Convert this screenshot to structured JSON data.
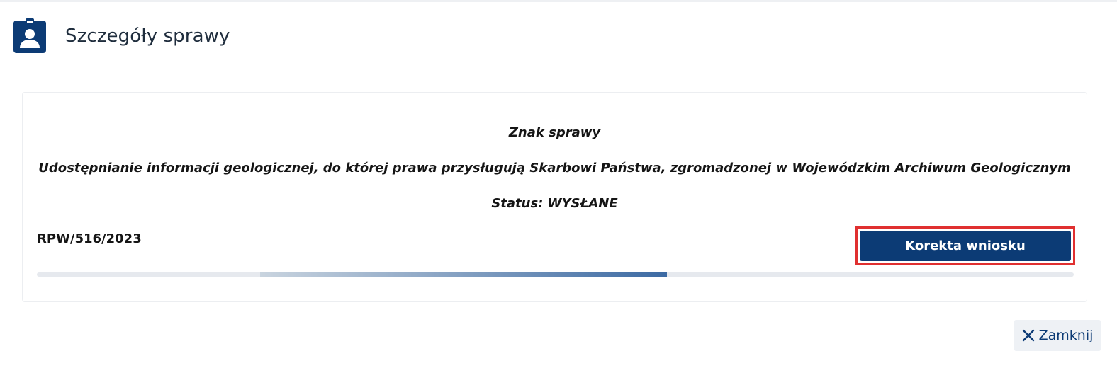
{
  "header": {
    "title": "Szczegóły sprawy",
    "icon": "id-badge-icon"
  },
  "case": {
    "label_title": "Znak sprawy",
    "description": "Udostępnianie informacji geologicznej, do której prawa przysługują Skarbowi Państwa, zgromadzonej w Wojewódzkim Archiwum Geologicznym",
    "status": "Status: WYSŁANE",
    "number": "RPW/516/2023",
    "progress": {
      "start_fraction": 0.215,
      "end_fraction": 0.608
    }
  },
  "actions": {
    "correction_label": "Korekta wniosku",
    "close_label": "Zamknij"
  },
  "colors": {
    "primary": "#0c3b75",
    "highlight_border": "#e03030"
  }
}
